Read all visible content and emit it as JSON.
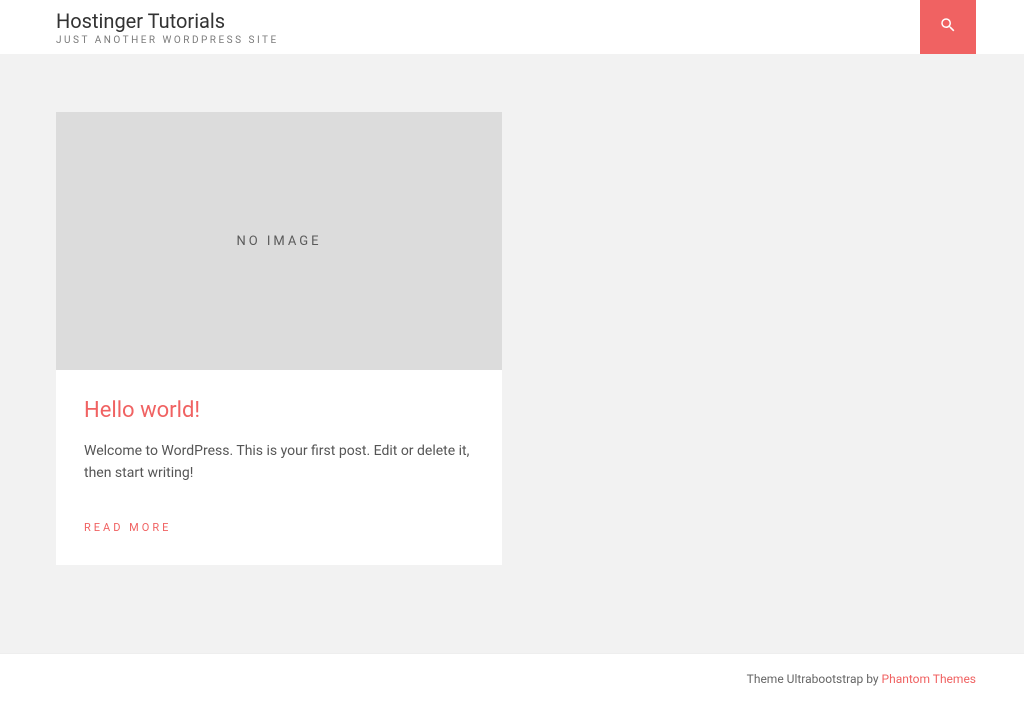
{
  "header": {
    "site_title": "Hostinger Tutorials",
    "site_tagline": "JUST ANOTHER WORDPRESS SITE"
  },
  "post": {
    "no_image_label": "NO IMAGE",
    "title": "Hello world!",
    "excerpt": "Welcome to WordPress. This is your first post. Edit or delete it, then start writing!",
    "read_more_label": "READ MORE"
  },
  "footer": {
    "credit_prefix": "Theme Ultrabootstrap by ",
    "credit_link": "Phantom Themes"
  },
  "colors": {
    "accent": "#f06262",
    "page_bg": "#f2f2f2",
    "card_bg": "#ffffff",
    "image_placeholder_bg": "#dcdcdc"
  }
}
